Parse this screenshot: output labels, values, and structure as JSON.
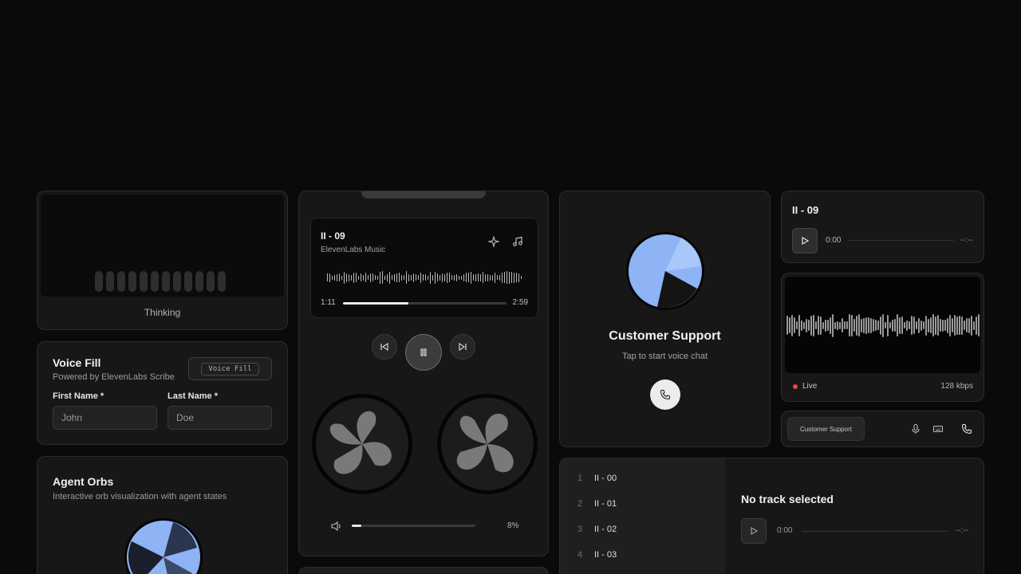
{
  "thinking_card": {
    "label": "Thinking"
  },
  "voice_fill": {
    "title": "Voice Fill",
    "subtitle": "Powered by ElevenLabs Scribe",
    "button_label": "Voice Fill",
    "first_name_label": "First Name *",
    "first_name_placeholder": "John",
    "last_name_label": "Last Name *",
    "last_name_placeholder": "Doe"
  },
  "agent_orbs": {
    "title": "Agent Orbs",
    "subtitle": "Interactive orb visualization with agent states"
  },
  "music_player": {
    "track_title": "II - 09",
    "artist": "ElevenLabs Music",
    "current_time": "1:11",
    "duration": "2:59",
    "progress": 0.4,
    "volume_percent": "8%",
    "volume_level": 0.08
  },
  "customer_support": {
    "title": "Customer Support",
    "subtitle": "Tap to start voice chat"
  },
  "mini_player": {
    "track_title": "II - 09",
    "current_time": "0:00",
    "duration": "--:--"
  },
  "live_stream": {
    "status": "Live",
    "bitrate": "128 kbps",
    "status_color": "#ef4444"
  },
  "support_bar": {
    "label": "Customer Support"
  },
  "playlist": {
    "tracks": [
      {
        "num": "1",
        "title": "II - 00"
      },
      {
        "num": "2",
        "title": "II - 01"
      },
      {
        "num": "3",
        "title": "II - 02"
      },
      {
        "num": "4",
        "title": "II - 03"
      }
    ],
    "empty_title": "No track selected",
    "current_time": "0:00",
    "duration": "--:--"
  }
}
